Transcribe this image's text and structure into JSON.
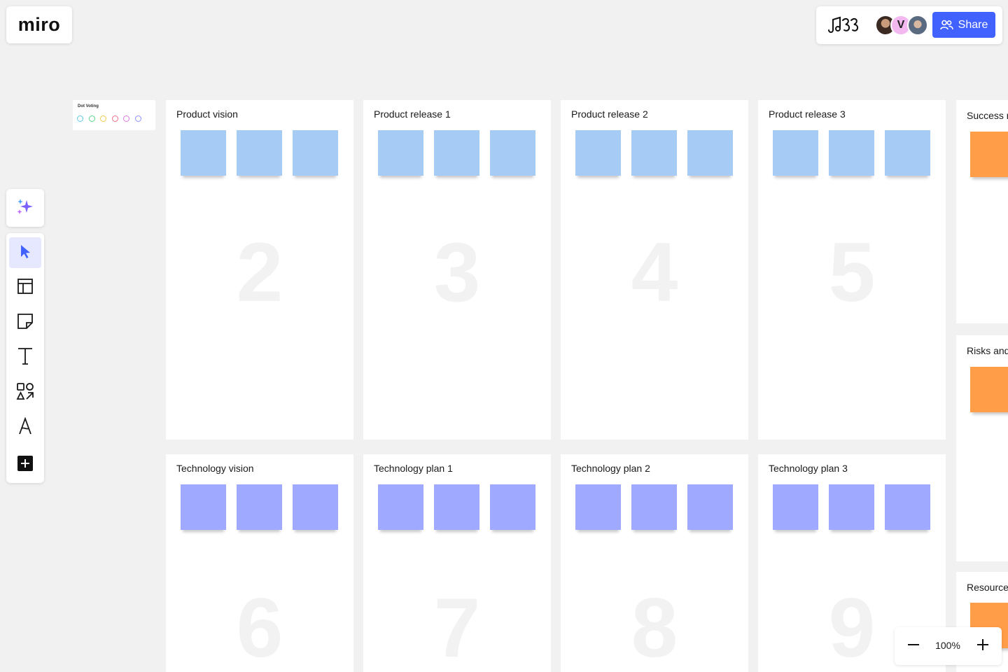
{
  "app": {
    "logo_text": "miro"
  },
  "header": {
    "reactions_icon": "music-notes-reaction-icon",
    "collaborators": [
      {
        "name": "collaborator-photo-1",
        "initial": ""
      },
      {
        "name": "collaborator-v",
        "initial": "V"
      },
      {
        "name": "collaborator-photo-2",
        "initial": ""
      }
    ],
    "share_label": "Share",
    "share_color": "#4262ff"
  },
  "dot_voting": {
    "title": "Dot Voting",
    "dot_colors": [
      "#62c8e8",
      "#5cd68a",
      "#f2c94c",
      "#f0708a",
      "#e07ae0",
      "#8a8fff"
    ]
  },
  "toolbar": {
    "ai_icon": "sparkle-icon",
    "tools": [
      {
        "name": "select-tool",
        "icon": "cursor-icon",
        "active": true
      },
      {
        "name": "templates-tool",
        "icon": "templates-icon",
        "active": false
      },
      {
        "name": "sticky-note-tool",
        "icon": "sticky-note-icon",
        "active": false
      },
      {
        "name": "text-tool",
        "icon": "text-icon",
        "active": false
      },
      {
        "name": "shapes-tool",
        "icon": "shapes-icon",
        "active": false
      },
      {
        "name": "pen-tool",
        "icon": "pen-icon",
        "active": false
      },
      {
        "name": "more-tools",
        "icon": "plus-square-icon",
        "active": false
      }
    ]
  },
  "frames": {
    "product": [
      {
        "title": "Product vision",
        "number": "2"
      },
      {
        "title": "Product release 1",
        "number": "3"
      },
      {
        "title": "Product release 2",
        "number": "4"
      },
      {
        "title": "Product release 3",
        "number": "5"
      }
    ],
    "technology": [
      {
        "title": "Technology vision",
        "number": "6"
      },
      {
        "title": "Technology plan 1",
        "number": "7"
      },
      {
        "title": "Technology plan 2",
        "number": "8"
      },
      {
        "title": "Technology plan 3",
        "number": "9"
      }
    ],
    "side": [
      {
        "title": "Success r"
      },
      {
        "title": "Risks and"
      },
      {
        "title": "Resource"
      }
    ]
  },
  "sticky_colors": {
    "product": "#a6ccf5",
    "technology": "#9ea9ff",
    "side": "#ff9d48"
  },
  "zoom": {
    "level": "100%"
  }
}
